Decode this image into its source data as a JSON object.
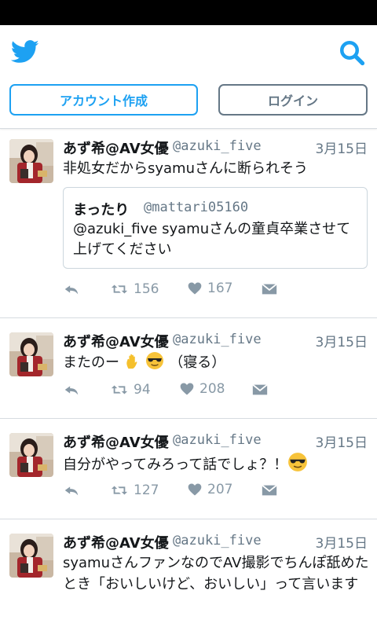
{
  "header": {
    "signup_label": "アカウント作成",
    "login_label": "ログイン",
    "brand_color": "#1da1f2",
    "icons": [
      "twitter-bird-icon",
      "search-icon"
    ]
  },
  "tweets": [
    {
      "name": "あず希@AV女優",
      "handle": "@azuki_five",
      "date": "3月15日",
      "text": "非処女だからsyamuさんに断られそう",
      "quote": {
        "name": "まったり",
        "handle": "@mattari05160",
        "text": "@azuki_five syamuさんの童貞卒業させて上げてください"
      },
      "retweets": "156",
      "likes": "167"
    },
    {
      "name": "あず希@AV女優",
      "handle": "@azuki_five",
      "date": "3月15日",
      "text_before": "またのー ",
      "text_after": " （寝る）",
      "retweets": "94",
      "likes": "208"
    },
    {
      "name": "あず希@AV女優",
      "handle": "@azuki_five",
      "date": "3月15日",
      "text_before": "自分がやってみろって話でしょ？！",
      "retweets": "127",
      "likes": "207"
    },
    {
      "name": "あず希@AV女優",
      "handle": "@azuki_five",
      "date": "3月15日",
      "text": "syamuさんファンなのでAV撮影でちんぽ舐めたとき「おいしいけど、おいしい」って言います"
    }
  ]
}
